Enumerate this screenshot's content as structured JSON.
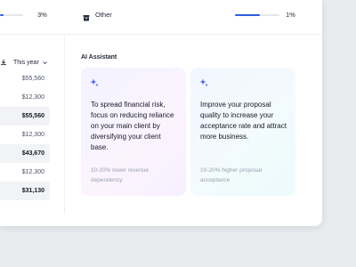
{
  "top": {
    "left_pct": "3%",
    "left_bar_fraction": 0.15,
    "other_label": "Other",
    "right_pct": "1%",
    "right_bar_fraction": 0.55
  },
  "table": {
    "header_label": "This year",
    "values": [
      {
        "value": "$55,560",
        "highlight": false
      },
      {
        "value": "$12,300",
        "highlight": false
      },
      {
        "value": "$55,560",
        "highlight": true
      },
      {
        "value": "$12,300",
        "highlight": false
      },
      {
        "value": "$43,670",
        "highlight": true
      },
      {
        "value": "$12,300",
        "highlight": false
      },
      {
        "value": "$31,130",
        "highlight": true
      }
    ]
  },
  "assistant": {
    "title": "AI Assistant",
    "cards": [
      {
        "message": "To spread financial risk, focus on reducing reliance on your main client by diversifying your client base.",
        "note": "10-20% lower revenue dependency"
      },
      {
        "message": "Improve your proposal quality to increase your acceptance rate and attract more business.",
        "note": "10-20% higher proposal acceptance"
      }
    ]
  },
  "colors": {
    "accent": "#2f5fe0",
    "sparkle": "#4b63f0"
  },
  "icons": [
    "download-icon",
    "chevron-down-icon",
    "folder-icon",
    "sparkle-icon"
  ]
}
